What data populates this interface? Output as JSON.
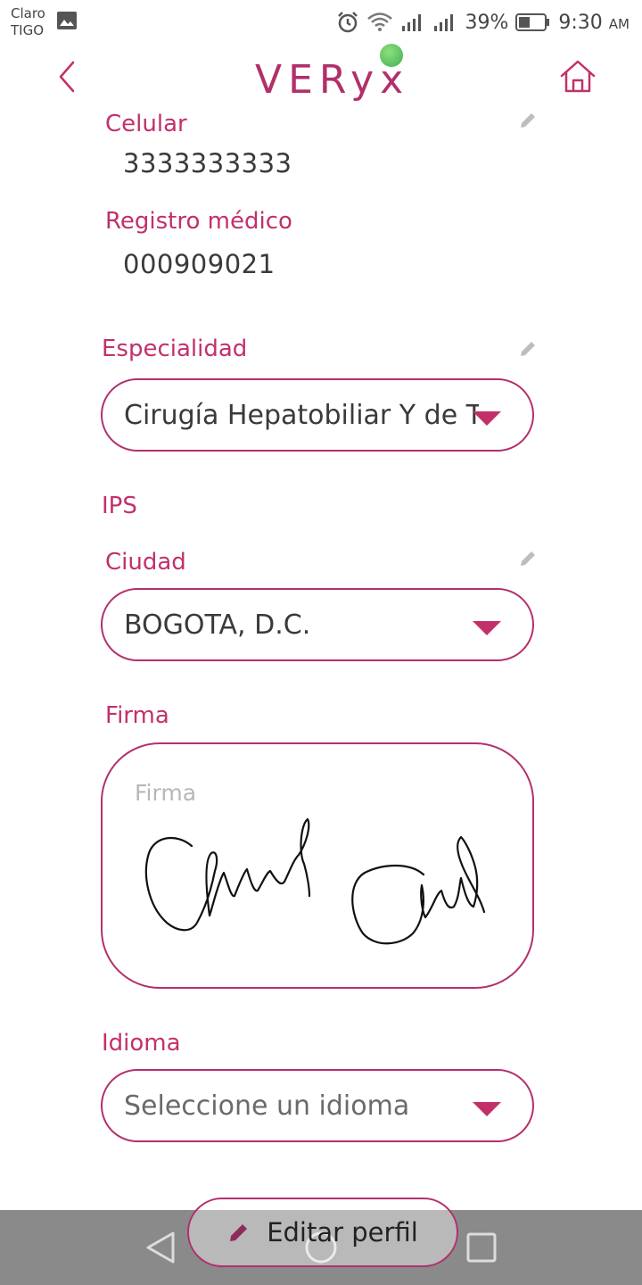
{
  "status_bar": {
    "carrier_line1": "Claro",
    "carrier_line2": "TIGO",
    "battery": "39%",
    "time": "9:30",
    "ampm": "AM"
  },
  "header": {
    "logo": "VERyx",
    "logo_dot_color": "#5cc16a",
    "icons": [
      "chevron-left-icon",
      "home-icon"
    ]
  },
  "profile": {
    "celular": {
      "label": "Celular",
      "value": "3333333333"
    },
    "registro": {
      "label": "Registro médico",
      "value": "000909021"
    },
    "especialidad": {
      "label": "Especialidad",
      "value": "Cirugía Hepatobiliar Y de Trar"
    },
    "ips": {
      "label": "IPS"
    },
    "ciudad": {
      "label": "Ciudad",
      "value": "BOGOTA, D.C."
    },
    "firma": {
      "label": "Firma",
      "placeholder": "Firma"
    },
    "idioma": {
      "label": "Idioma",
      "placeholder": "Seleccione un idioma"
    }
  },
  "actions": {
    "edit_label": "Editar perfil"
  },
  "colors": {
    "accent": "#c2306c",
    "accent_dark": "#8f2a5e",
    "nav_bar": "#8a8a8a"
  }
}
